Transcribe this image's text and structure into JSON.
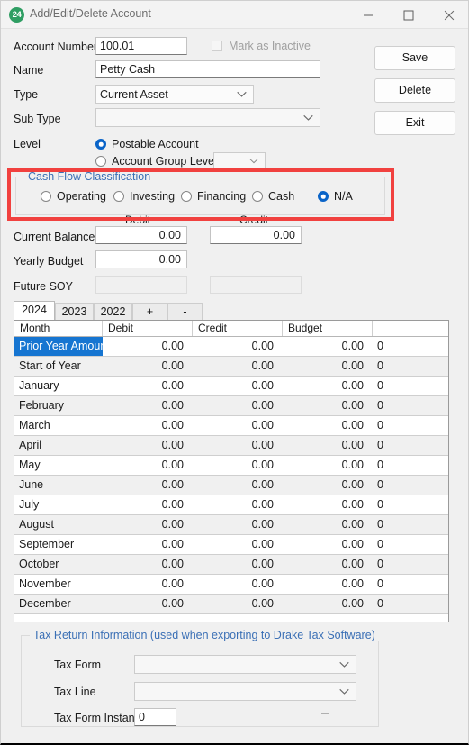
{
  "window": {
    "title": "Add/Edit/Delete Account",
    "icon_label": "24",
    "icon_name": "app-logo-24-icon",
    "controls": {
      "minimize": "minimize-icon",
      "maximize": "maximize-icon",
      "close": "close-icon"
    }
  },
  "form": {
    "account_number_label": "Account Number",
    "account_number_value": "100.01",
    "mark_inactive_label": "Mark as Inactive",
    "mark_inactive_checked": false,
    "name_label": "Name",
    "name_value": "Petty Cash",
    "type_label": "Type",
    "type_value": "Current Asset",
    "sub_type_label": "Sub Type",
    "sub_type_value": "",
    "level_label": "Level",
    "level_options": [
      {
        "label": "Postable Account",
        "selected": true
      },
      {
        "label": "Account Group Level",
        "selected": false
      }
    ],
    "account_group_value": ""
  },
  "cash_flow": {
    "legend": "Cash Flow Classification",
    "options": [
      {
        "label": "Operating",
        "selected": false
      },
      {
        "label": "Investing",
        "selected": false
      },
      {
        "label": "Financing",
        "selected": false
      },
      {
        "label": "Cash",
        "selected": false
      },
      {
        "label": "N/A",
        "selected": true
      }
    ],
    "highlight_color": "#f1413f"
  },
  "balances": {
    "debit_header": "Debit",
    "credit_header": "Credit",
    "rows": [
      {
        "label": "Current Balance",
        "debit": "0.00",
        "credit": "0.00",
        "credit_enabled": true
      },
      {
        "label": "Yearly Budget",
        "debit": "0.00",
        "credit": "",
        "credit_enabled": false
      },
      {
        "label": "Future SOY",
        "debit": "",
        "credit": "",
        "credit_enabled": true
      }
    ]
  },
  "year_tabs": [
    {
      "label": "2024",
      "active": true
    },
    {
      "label": "2023",
      "active": false
    },
    {
      "label": "2022",
      "active": false
    },
    {
      "label": "+",
      "active": false
    },
    {
      "label": "-",
      "active": false
    }
  ],
  "grid": {
    "columns": [
      "Month",
      "Debit",
      "Credit",
      "Budget",
      ""
    ],
    "rows": [
      {
        "month": "Prior Year Amount",
        "debit": "0.00",
        "credit": "0.00",
        "budget": "0.00",
        "extra": "0",
        "selected": true
      },
      {
        "month": "Start of Year",
        "debit": "0.00",
        "credit": "0.00",
        "budget": "0.00",
        "extra": "0",
        "selected": false
      },
      {
        "month": "January",
        "debit": "0.00",
        "credit": "0.00",
        "budget": "0.00",
        "extra": "0",
        "selected": false
      },
      {
        "month": "February",
        "debit": "0.00",
        "credit": "0.00",
        "budget": "0.00",
        "extra": "0",
        "selected": false
      },
      {
        "month": "March",
        "debit": "0.00",
        "credit": "0.00",
        "budget": "0.00",
        "extra": "0",
        "selected": false
      },
      {
        "month": "April",
        "debit": "0.00",
        "credit": "0.00",
        "budget": "0.00",
        "extra": "0",
        "selected": false
      },
      {
        "month": "May",
        "debit": "0.00",
        "credit": "0.00",
        "budget": "0.00",
        "extra": "0",
        "selected": false
      },
      {
        "month": "June",
        "debit": "0.00",
        "credit": "0.00",
        "budget": "0.00",
        "extra": "0",
        "selected": false
      },
      {
        "month": "July",
        "debit": "0.00",
        "credit": "0.00",
        "budget": "0.00",
        "extra": "0",
        "selected": false
      },
      {
        "month": "August",
        "debit": "0.00",
        "credit": "0.00",
        "budget": "0.00",
        "extra": "0",
        "selected": false
      },
      {
        "month": "September",
        "debit": "0.00",
        "credit": "0.00",
        "budget": "0.00",
        "extra": "0",
        "selected": false
      },
      {
        "month": "October",
        "debit": "0.00",
        "credit": "0.00",
        "budget": "0.00",
        "extra": "0",
        "selected": false
      },
      {
        "month": "November",
        "debit": "0.00",
        "credit": "0.00",
        "budget": "0.00",
        "extra": "0",
        "selected": false
      },
      {
        "month": "December",
        "debit": "0.00",
        "credit": "0.00",
        "budget": "0.00",
        "extra": "0",
        "selected": false
      }
    ]
  },
  "tax": {
    "legend": "Tax Return Information (used when exporting to Drake Tax Software)",
    "tax_form_label": "Tax Form",
    "tax_form_value": "",
    "tax_line_label": "Tax Line",
    "tax_line_value": "",
    "tax_form_instance_label": "Tax Form Instance",
    "tax_form_instance_value": "0"
  },
  "actions": {
    "save": "Save",
    "delete": "Delete",
    "exit": "Exit"
  }
}
